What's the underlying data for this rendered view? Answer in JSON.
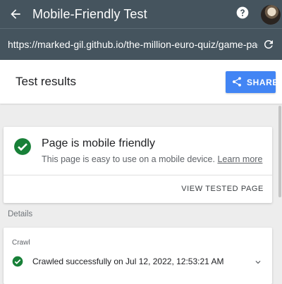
{
  "appbar": {
    "title": "Mobile-Friendly Test",
    "back_icon": "arrow-back-icon",
    "help_icon": "help-icon"
  },
  "urlbar": {
    "url": "https://marked-gil.github.io/the-million-euro-quiz/game-page.html",
    "refresh_icon": "refresh-icon"
  },
  "results": {
    "title": "Test results",
    "share_label": "SHARE"
  },
  "status": {
    "heading": "Page is mobile friendly",
    "description": "This page is easy to use on a mobile device.",
    "learn_more": "Learn more",
    "view_tested_page": "VIEW TESTED PAGE",
    "color": "#188038"
  },
  "details": {
    "label": "Details",
    "crawl": {
      "label": "Crawl",
      "text": "Crawled successfully on Jul 12, 2022, 12:53:21 AM"
    }
  },
  "colors": {
    "header": "#45545e",
    "accent": "#4285f4",
    "success": "#188038"
  }
}
